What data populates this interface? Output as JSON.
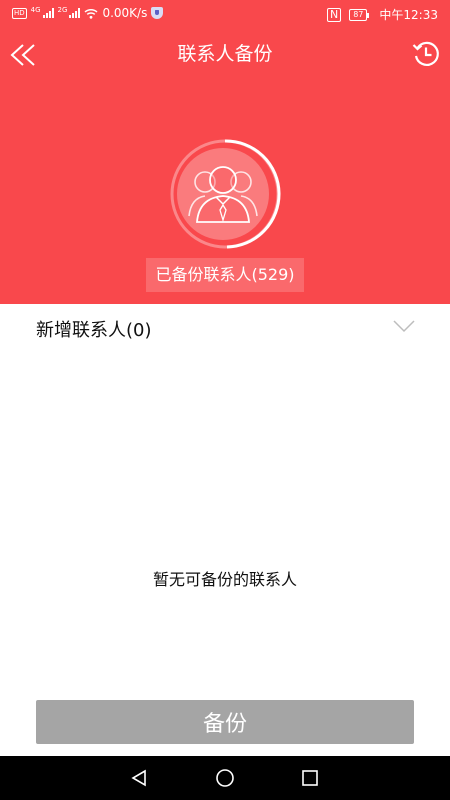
{
  "status_bar": {
    "hd": "HD",
    "network_1": "4G",
    "network_2": "2G",
    "speed": "0.00K/s",
    "nfc": "N",
    "battery": "87",
    "time": "中午12:33"
  },
  "header": {
    "title": "联系人备份"
  },
  "summary": {
    "backed_up_label": "已备份联系人(529)"
  },
  "new_contacts": {
    "label": "新增联系人(0)"
  },
  "empty_state": {
    "message": "暂无可备份的联系人"
  },
  "actions": {
    "backup_label": "备份"
  },
  "colors": {
    "brand": "#f9484c",
    "button_disabled": "#a5a5a5",
    "nav_bar": "#000000"
  },
  "icons": {
    "back": "double-chevron-left-icon",
    "history": "history-clock-icon",
    "avatar": "contacts-group-icon",
    "expand": "chevron-down-icon",
    "nav_back": "triangle-back-icon",
    "nav_home": "circle-home-icon",
    "nav_recent": "square-recent-icon"
  }
}
